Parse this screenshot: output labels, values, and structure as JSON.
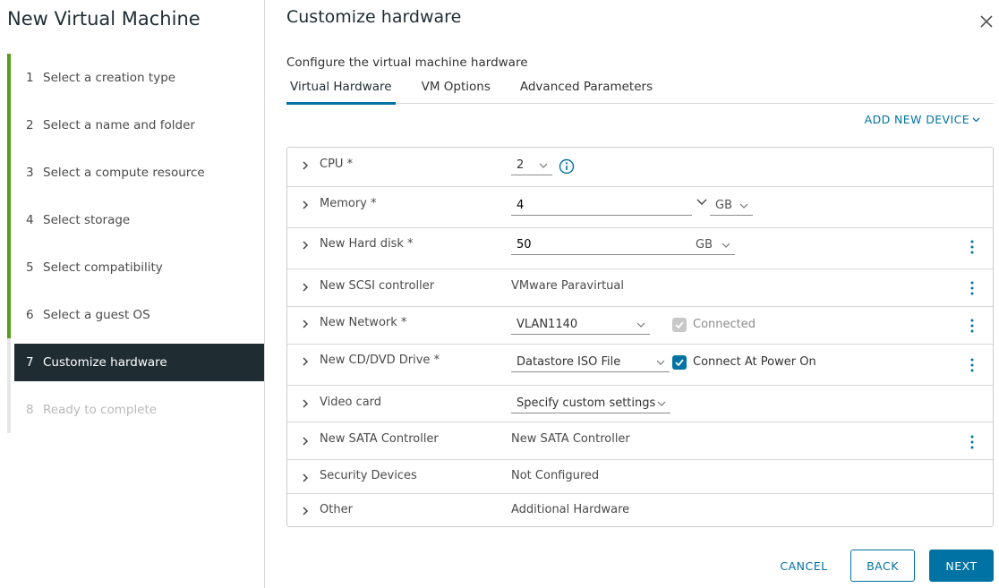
{
  "wizard": {
    "title": "New Virtual Machine",
    "steps": [
      {
        "num": "1",
        "label": "Select a creation type"
      },
      {
        "num": "2",
        "label": "Select a name and folder"
      },
      {
        "num": "3",
        "label": "Select a compute resource"
      },
      {
        "num": "4",
        "label": "Select storage"
      },
      {
        "num": "5",
        "label": "Select compatibility"
      },
      {
        "num": "6",
        "label": "Select a guest OS"
      },
      {
        "num": "7",
        "label": "Customize hardware"
      },
      {
        "num": "8",
        "label": "Ready to complete"
      }
    ]
  },
  "main": {
    "title": "Customize hardware",
    "subtitle": "Configure the virtual machine hardware",
    "tabs": [
      {
        "label": "Virtual Hardware"
      },
      {
        "label": "VM Options"
      },
      {
        "label": "Advanced Parameters"
      }
    ],
    "add_device_label": "ADD NEW DEVICE"
  },
  "hardware": {
    "cpu": {
      "label": "CPU *",
      "value": "2"
    },
    "memory": {
      "label": "Memory *",
      "value": "4",
      "unit": "GB"
    },
    "hard_disk": {
      "label": "New Hard disk *",
      "value": "50",
      "unit": "GB"
    },
    "scsi": {
      "label": "New SCSI controller",
      "value": "VMware Paravirtual"
    },
    "network": {
      "label": "New Network *",
      "value": "VLAN1140",
      "connected_label": "Connected"
    },
    "cdrom": {
      "label": "New CD/DVD Drive *",
      "value": "Datastore ISO File",
      "connect_label": "Connect At Power On"
    },
    "video": {
      "label": "Video card",
      "value": "Specify custom settings"
    },
    "sata": {
      "label": "New SATA Controller",
      "value": "New SATA Controller"
    },
    "security": {
      "label": "Security Devices",
      "value": "Not Configured"
    },
    "other": {
      "label": "Other",
      "value": "Additional Hardware"
    }
  },
  "footer": {
    "cancel_label": "CANCEL",
    "back_label": "BACK",
    "next_label": "NEXT"
  },
  "colors": {
    "accent": "#0072a3",
    "completed_rail": "#5a9a1a",
    "current_step_bg": "#1f2d33"
  }
}
